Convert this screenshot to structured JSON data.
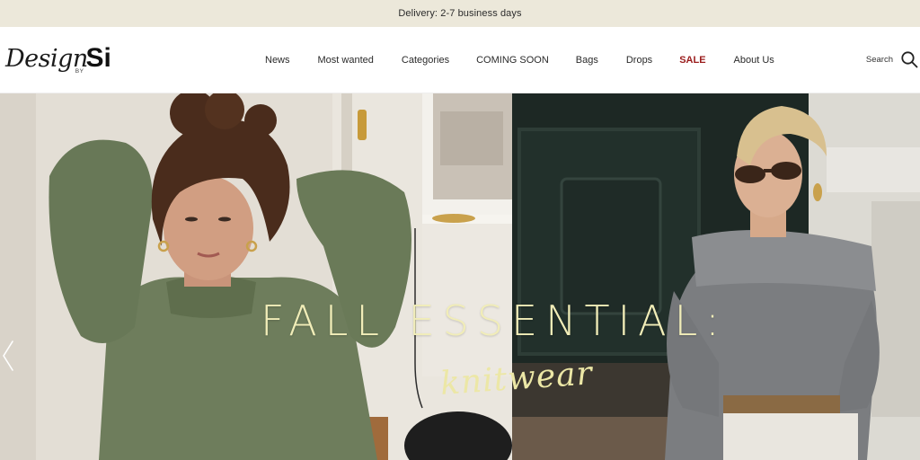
{
  "announcement": {
    "text": "Delivery: 2-7 business days"
  },
  "logo": {
    "script": "Design",
    "by": "BY",
    "mark": "Si"
  },
  "nav": {
    "items": [
      {
        "label": "News"
      },
      {
        "label": "Most wanted"
      },
      {
        "label": "Categories"
      },
      {
        "label": "COMING SOON"
      },
      {
        "label": "Bags"
      },
      {
        "label": "Drops"
      },
      {
        "label": "SALE"
      },
      {
        "label": "About Us"
      }
    ]
  },
  "search": {
    "label": "Search",
    "icon": "search-icon"
  },
  "hero": {
    "title": "FALL ESSENTIAL:",
    "subtitle": "knitwear",
    "prev_icon": "chevron-left-icon",
    "colors": {
      "title": "#f1edb8",
      "sale": "#9a1b1b",
      "announcement_bg": "#ece8da"
    }
  }
}
